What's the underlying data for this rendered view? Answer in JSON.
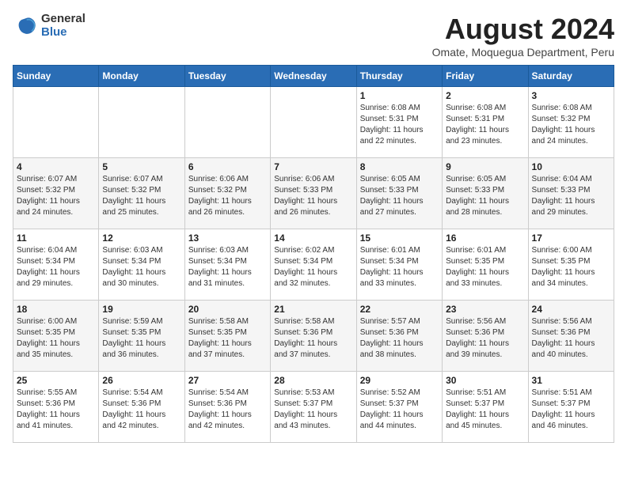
{
  "header": {
    "logo_general": "General",
    "logo_blue": "Blue",
    "title": "August 2024",
    "location": "Omate, Moquegua Department, Peru"
  },
  "days_of_week": [
    "Sunday",
    "Monday",
    "Tuesday",
    "Wednesday",
    "Thursday",
    "Friday",
    "Saturday"
  ],
  "weeks": [
    [
      {
        "day": "",
        "info": ""
      },
      {
        "day": "",
        "info": ""
      },
      {
        "day": "",
        "info": ""
      },
      {
        "day": "",
        "info": ""
      },
      {
        "day": "1",
        "info": "Sunrise: 6:08 AM\nSunset: 5:31 PM\nDaylight: 11 hours\nand 22 minutes."
      },
      {
        "day": "2",
        "info": "Sunrise: 6:08 AM\nSunset: 5:31 PM\nDaylight: 11 hours\nand 23 minutes."
      },
      {
        "day": "3",
        "info": "Sunrise: 6:08 AM\nSunset: 5:32 PM\nDaylight: 11 hours\nand 24 minutes."
      }
    ],
    [
      {
        "day": "4",
        "info": "Sunrise: 6:07 AM\nSunset: 5:32 PM\nDaylight: 11 hours\nand 24 minutes."
      },
      {
        "day": "5",
        "info": "Sunrise: 6:07 AM\nSunset: 5:32 PM\nDaylight: 11 hours\nand 25 minutes."
      },
      {
        "day": "6",
        "info": "Sunrise: 6:06 AM\nSunset: 5:32 PM\nDaylight: 11 hours\nand 26 minutes."
      },
      {
        "day": "7",
        "info": "Sunrise: 6:06 AM\nSunset: 5:33 PM\nDaylight: 11 hours\nand 26 minutes."
      },
      {
        "day": "8",
        "info": "Sunrise: 6:05 AM\nSunset: 5:33 PM\nDaylight: 11 hours\nand 27 minutes."
      },
      {
        "day": "9",
        "info": "Sunrise: 6:05 AM\nSunset: 5:33 PM\nDaylight: 11 hours\nand 28 minutes."
      },
      {
        "day": "10",
        "info": "Sunrise: 6:04 AM\nSunset: 5:33 PM\nDaylight: 11 hours\nand 29 minutes."
      }
    ],
    [
      {
        "day": "11",
        "info": "Sunrise: 6:04 AM\nSunset: 5:34 PM\nDaylight: 11 hours\nand 29 minutes."
      },
      {
        "day": "12",
        "info": "Sunrise: 6:03 AM\nSunset: 5:34 PM\nDaylight: 11 hours\nand 30 minutes."
      },
      {
        "day": "13",
        "info": "Sunrise: 6:03 AM\nSunset: 5:34 PM\nDaylight: 11 hours\nand 31 minutes."
      },
      {
        "day": "14",
        "info": "Sunrise: 6:02 AM\nSunset: 5:34 PM\nDaylight: 11 hours\nand 32 minutes."
      },
      {
        "day": "15",
        "info": "Sunrise: 6:01 AM\nSunset: 5:34 PM\nDaylight: 11 hours\nand 33 minutes."
      },
      {
        "day": "16",
        "info": "Sunrise: 6:01 AM\nSunset: 5:35 PM\nDaylight: 11 hours\nand 33 minutes."
      },
      {
        "day": "17",
        "info": "Sunrise: 6:00 AM\nSunset: 5:35 PM\nDaylight: 11 hours\nand 34 minutes."
      }
    ],
    [
      {
        "day": "18",
        "info": "Sunrise: 6:00 AM\nSunset: 5:35 PM\nDaylight: 11 hours\nand 35 minutes."
      },
      {
        "day": "19",
        "info": "Sunrise: 5:59 AM\nSunset: 5:35 PM\nDaylight: 11 hours\nand 36 minutes."
      },
      {
        "day": "20",
        "info": "Sunrise: 5:58 AM\nSunset: 5:35 PM\nDaylight: 11 hours\nand 37 minutes."
      },
      {
        "day": "21",
        "info": "Sunrise: 5:58 AM\nSunset: 5:36 PM\nDaylight: 11 hours\nand 37 minutes."
      },
      {
        "day": "22",
        "info": "Sunrise: 5:57 AM\nSunset: 5:36 PM\nDaylight: 11 hours\nand 38 minutes."
      },
      {
        "day": "23",
        "info": "Sunrise: 5:56 AM\nSunset: 5:36 PM\nDaylight: 11 hours\nand 39 minutes."
      },
      {
        "day": "24",
        "info": "Sunrise: 5:56 AM\nSunset: 5:36 PM\nDaylight: 11 hours\nand 40 minutes."
      }
    ],
    [
      {
        "day": "25",
        "info": "Sunrise: 5:55 AM\nSunset: 5:36 PM\nDaylight: 11 hours\nand 41 minutes."
      },
      {
        "day": "26",
        "info": "Sunrise: 5:54 AM\nSunset: 5:36 PM\nDaylight: 11 hours\nand 42 minutes."
      },
      {
        "day": "27",
        "info": "Sunrise: 5:54 AM\nSunset: 5:36 PM\nDaylight: 11 hours\nand 42 minutes."
      },
      {
        "day": "28",
        "info": "Sunrise: 5:53 AM\nSunset: 5:37 PM\nDaylight: 11 hours\nand 43 minutes."
      },
      {
        "day": "29",
        "info": "Sunrise: 5:52 AM\nSunset: 5:37 PM\nDaylight: 11 hours\nand 44 minutes."
      },
      {
        "day": "30",
        "info": "Sunrise: 5:51 AM\nSunset: 5:37 PM\nDaylight: 11 hours\nand 45 minutes."
      },
      {
        "day": "31",
        "info": "Sunrise: 5:51 AM\nSunset: 5:37 PM\nDaylight: 11 hours\nand 46 minutes."
      }
    ]
  ]
}
